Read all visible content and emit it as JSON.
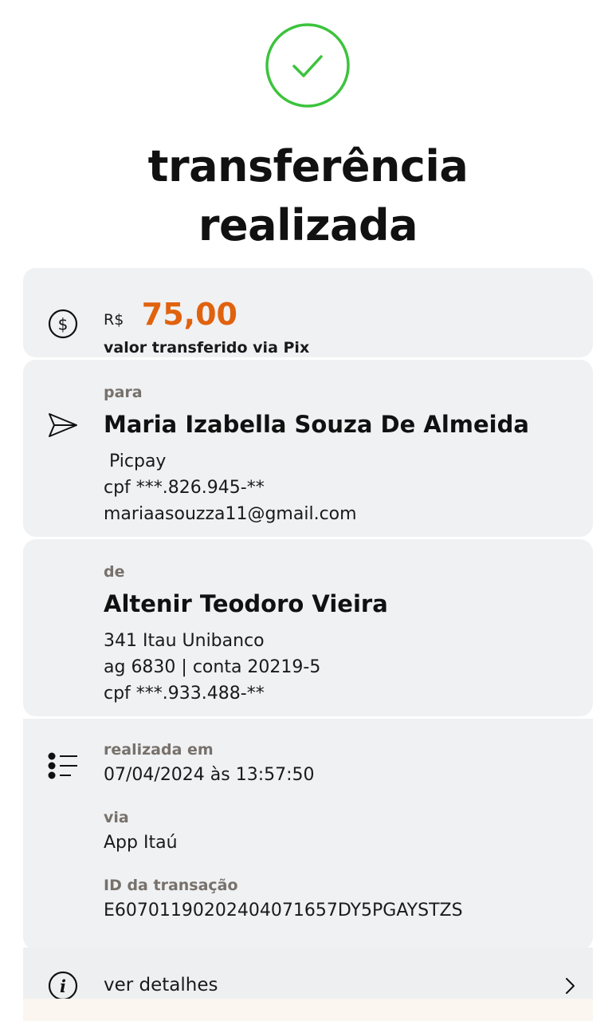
{
  "header": {
    "title_line1": "transferência",
    "title_line2": "realizada"
  },
  "amount": {
    "currency": "R$",
    "value": "75,00",
    "subtitle": "valor transferido via Pix"
  },
  "recipient": {
    "label": "para",
    "name": "Maria Izabella Souza De Almeida",
    "bank": " Picpay",
    "cpf": "cpf ***.826.945-**",
    "email": "mariaasouzza11@gmail.com"
  },
  "sender": {
    "label": "de",
    "name": "Altenir Teodoro Vieira",
    "bank": "341 Itau Unibanco",
    "account": "ag 6830 | conta 20219-5",
    "cpf": "cpf ***.933.488-**"
  },
  "details": {
    "date_label": "realizada em",
    "date_value": "07/04/2024 às 13:57:50",
    "via_label": "via",
    "via_value": "App Itaú",
    "id_label": "ID da transação",
    "id_value": "E60701190202404071657DY5PGAYSTZS"
  },
  "footer": {
    "details_label": "ver detalhes"
  },
  "colors": {
    "accent": "#e0620e",
    "success": "#3cc33c",
    "card_bg": "#f0f1f3",
    "label": "#77716b"
  },
  "icons": {
    "success": "check-circle-icon",
    "amount": "dollar-circle-icon",
    "recipient": "send-icon",
    "details": "list-icon",
    "info": "info-icon",
    "chevron": "chevron-right-icon"
  }
}
